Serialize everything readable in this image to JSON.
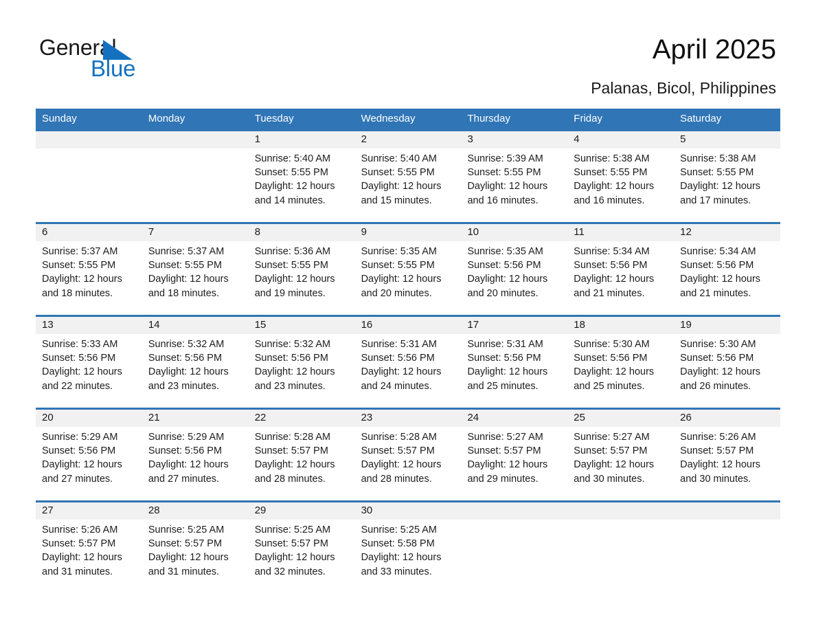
{
  "brand": {
    "name_part1": "General",
    "name_part2": "Blue",
    "triangle_icon": "triangle-icon",
    "accent_color": "#1471c0"
  },
  "header": {
    "month_title": "April 2025",
    "location": "Palanas, Bicol, Philippines"
  },
  "theme": {
    "header_blue": "#3075b5",
    "daynum_band": "#f1f1f1",
    "text": "#1a1a1a"
  },
  "weekday_headers": [
    "Sunday",
    "Monday",
    "Tuesday",
    "Wednesday",
    "Thursday",
    "Friday",
    "Saturday"
  ],
  "weeks": [
    [
      {
        "day": "",
        "sunrise": "",
        "sunset": "",
        "daylight1": "",
        "daylight2": ""
      },
      {
        "day": "",
        "sunrise": "",
        "sunset": "",
        "daylight1": "",
        "daylight2": ""
      },
      {
        "day": "1",
        "sunrise": "Sunrise: 5:40 AM",
        "sunset": "Sunset: 5:55 PM",
        "daylight1": "Daylight: 12 hours",
        "daylight2": "and 14 minutes."
      },
      {
        "day": "2",
        "sunrise": "Sunrise: 5:40 AM",
        "sunset": "Sunset: 5:55 PM",
        "daylight1": "Daylight: 12 hours",
        "daylight2": "and 15 minutes."
      },
      {
        "day": "3",
        "sunrise": "Sunrise: 5:39 AM",
        "sunset": "Sunset: 5:55 PM",
        "daylight1": "Daylight: 12 hours",
        "daylight2": "and 16 minutes."
      },
      {
        "day": "4",
        "sunrise": "Sunrise: 5:38 AM",
        "sunset": "Sunset: 5:55 PM",
        "daylight1": "Daylight: 12 hours",
        "daylight2": "and 16 minutes."
      },
      {
        "day": "5",
        "sunrise": "Sunrise: 5:38 AM",
        "sunset": "Sunset: 5:55 PM",
        "daylight1": "Daylight: 12 hours",
        "daylight2": "and 17 minutes."
      }
    ],
    [
      {
        "day": "6",
        "sunrise": "Sunrise: 5:37 AM",
        "sunset": "Sunset: 5:55 PM",
        "daylight1": "Daylight: 12 hours",
        "daylight2": "and 18 minutes."
      },
      {
        "day": "7",
        "sunrise": "Sunrise: 5:37 AM",
        "sunset": "Sunset: 5:55 PM",
        "daylight1": "Daylight: 12 hours",
        "daylight2": "and 18 minutes."
      },
      {
        "day": "8",
        "sunrise": "Sunrise: 5:36 AM",
        "sunset": "Sunset: 5:55 PM",
        "daylight1": "Daylight: 12 hours",
        "daylight2": "and 19 minutes."
      },
      {
        "day": "9",
        "sunrise": "Sunrise: 5:35 AM",
        "sunset": "Sunset: 5:55 PM",
        "daylight1": "Daylight: 12 hours",
        "daylight2": "and 20 minutes."
      },
      {
        "day": "10",
        "sunrise": "Sunrise: 5:35 AM",
        "sunset": "Sunset: 5:56 PM",
        "daylight1": "Daylight: 12 hours",
        "daylight2": "and 20 minutes."
      },
      {
        "day": "11",
        "sunrise": "Sunrise: 5:34 AM",
        "sunset": "Sunset: 5:56 PM",
        "daylight1": "Daylight: 12 hours",
        "daylight2": "and 21 minutes."
      },
      {
        "day": "12",
        "sunrise": "Sunrise: 5:34 AM",
        "sunset": "Sunset: 5:56 PM",
        "daylight1": "Daylight: 12 hours",
        "daylight2": "and 21 minutes."
      }
    ],
    [
      {
        "day": "13",
        "sunrise": "Sunrise: 5:33 AM",
        "sunset": "Sunset: 5:56 PM",
        "daylight1": "Daylight: 12 hours",
        "daylight2": "and 22 minutes."
      },
      {
        "day": "14",
        "sunrise": "Sunrise: 5:32 AM",
        "sunset": "Sunset: 5:56 PM",
        "daylight1": "Daylight: 12 hours",
        "daylight2": "and 23 minutes."
      },
      {
        "day": "15",
        "sunrise": "Sunrise: 5:32 AM",
        "sunset": "Sunset: 5:56 PM",
        "daylight1": "Daylight: 12 hours",
        "daylight2": "and 23 minutes."
      },
      {
        "day": "16",
        "sunrise": "Sunrise: 5:31 AM",
        "sunset": "Sunset: 5:56 PM",
        "daylight1": "Daylight: 12 hours",
        "daylight2": "and 24 minutes."
      },
      {
        "day": "17",
        "sunrise": "Sunrise: 5:31 AM",
        "sunset": "Sunset: 5:56 PM",
        "daylight1": "Daylight: 12 hours",
        "daylight2": "and 25 minutes."
      },
      {
        "day": "18",
        "sunrise": "Sunrise: 5:30 AM",
        "sunset": "Sunset: 5:56 PM",
        "daylight1": "Daylight: 12 hours",
        "daylight2": "and 25 minutes."
      },
      {
        "day": "19",
        "sunrise": "Sunrise: 5:30 AM",
        "sunset": "Sunset: 5:56 PM",
        "daylight1": "Daylight: 12 hours",
        "daylight2": "and 26 minutes."
      }
    ],
    [
      {
        "day": "20",
        "sunrise": "Sunrise: 5:29 AM",
        "sunset": "Sunset: 5:56 PM",
        "daylight1": "Daylight: 12 hours",
        "daylight2": "and 27 minutes."
      },
      {
        "day": "21",
        "sunrise": "Sunrise: 5:29 AM",
        "sunset": "Sunset: 5:56 PM",
        "daylight1": "Daylight: 12 hours",
        "daylight2": "and 27 minutes."
      },
      {
        "day": "22",
        "sunrise": "Sunrise: 5:28 AM",
        "sunset": "Sunset: 5:57 PM",
        "daylight1": "Daylight: 12 hours",
        "daylight2": "and 28 minutes."
      },
      {
        "day": "23",
        "sunrise": "Sunrise: 5:28 AM",
        "sunset": "Sunset: 5:57 PM",
        "daylight1": "Daylight: 12 hours",
        "daylight2": "and 28 minutes."
      },
      {
        "day": "24",
        "sunrise": "Sunrise: 5:27 AM",
        "sunset": "Sunset: 5:57 PM",
        "daylight1": "Daylight: 12 hours",
        "daylight2": "and 29 minutes."
      },
      {
        "day": "25",
        "sunrise": "Sunrise: 5:27 AM",
        "sunset": "Sunset: 5:57 PM",
        "daylight1": "Daylight: 12 hours",
        "daylight2": "and 30 minutes."
      },
      {
        "day": "26",
        "sunrise": "Sunrise: 5:26 AM",
        "sunset": "Sunset: 5:57 PM",
        "daylight1": "Daylight: 12 hours",
        "daylight2": "and 30 minutes."
      }
    ],
    [
      {
        "day": "27",
        "sunrise": "Sunrise: 5:26 AM",
        "sunset": "Sunset: 5:57 PM",
        "daylight1": "Daylight: 12 hours",
        "daylight2": "and 31 minutes."
      },
      {
        "day": "28",
        "sunrise": "Sunrise: 5:25 AM",
        "sunset": "Sunset: 5:57 PM",
        "daylight1": "Daylight: 12 hours",
        "daylight2": "and 31 minutes."
      },
      {
        "day": "29",
        "sunrise": "Sunrise: 5:25 AM",
        "sunset": "Sunset: 5:57 PM",
        "daylight1": "Daylight: 12 hours",
        "daylight2": "and 32 minutes."
      },
      {
        "day": "30",
        "sunrise": "Sunrise: 5:25 AM",
        "sunset": "Sunset: 5:58 PM",
        "daylight1": "Daylight: 12 hours",
        "daylight2": "and 33 minutes."
      },
      {
        "day": "",
        "sunrise": "",
        "sunset": "",
        "daylight1": "",
        "daylight2": ""
      },
      {
        "day": "",
        "sunrise": "",
        "sunset": "",
        "daylight1": "",
        "daylight2": ""
      },
      {
        "day": "",
        "sunrise": "",
        "sunset": "",
        "daylight1": "",
        "daylight2": ""
      }
    ]
  ]
}
